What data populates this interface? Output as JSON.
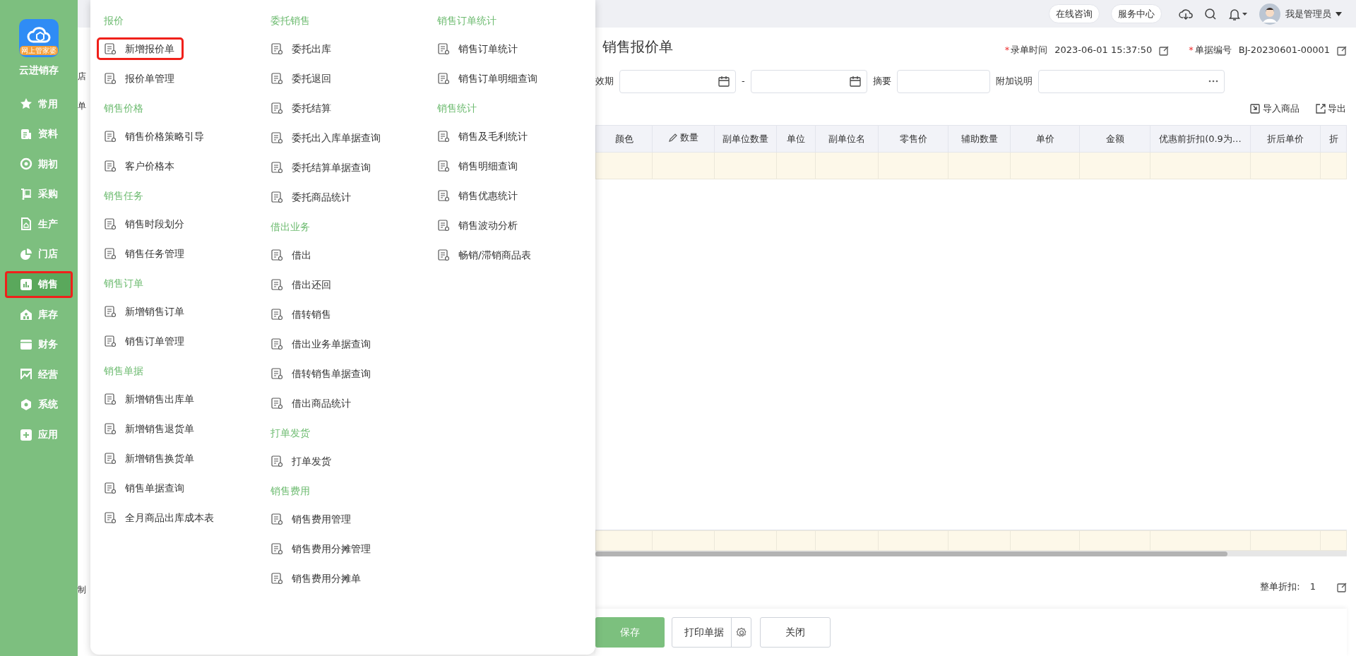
{
  "sidebar": {
    "logo_badge": "网上管家婆",
    "app_name": "云进销存",
    "items": [
      {
        "label": "常用",
        "selected": false,
        "highlighted": false
      },
      {
        "label": "资料",
        "selected": false,
        "highlighted": false
      },
      {
        "label": "期初",
        "selected": false,
        "highlighted": false
      },
      {
        "label": "采购",
        "selected": false,
        "highlighted": false
      },
      {
        "label": "生产",
        "selected": false,
        "highlighted": false
      },
      {
        "label": "门店",
        "selected": false,
        "highlighted": false
      },
      {
        "label": "销售",
        "selected": true,
        "highlighted": true
      },
      {
        "label": "库存",
        "selected": false,
        "highlighted": false
      },
      {
        "label": "财务",
        "selected": false,
        "highlighted": false
      },
      {
        "label": "经营",
        "selected": false,
        "highlighted": false
      },
      {
        "label": "系统",
        "selected": false,
        "highlighted": false
      },
      {
        "label": "应用",
        "selected": false,
        "highlighted": false
      }
    ]
  },
  "topbar": {
    "buttons": [
      "在线咨询",
      "服务中心"
    ],
    "user": "我是管理员"
  },
  "covered_labels": [
    "店",
    "单",
    "制"
  ],
  "menu": {
    "columns": [
      [
        {
          "title": "报价",
          "items": [
            {
              "label": "新增报价单",
              "highlighted": true
            },
            {
              "label": "报价单管理",
              "highlighted": false
            }
          ]
        },
        {
          "title": "销售价格",
          "items": [
            {
              "label": "销售价格策略引导",
              "highlighted": false
            },
            {
              "label": "客户价格本",
              "highlighted": false
            }
          ]
        },
        {
          "title": "销售任务",
          "items": [
            {
              "label": "销售时段划分",
              "highlighted": false
            },
            {
              "label": "销售任务管理",
              "highlighted": false
            }
          ]
        },
        {
          "title": "销售订单",
          "items": [
            {
              "label": "新增销售订单",
              "highlighted": false
            },
            {
              "label": "销售订单管理",
              "highlighted": false
            }
          ]
        },
        {
          "title": "销售单据",
          "items": [
            {
              "label": "新增销售出库单",
              "highlighted": false
            },
            {
              "label": "新增销售退货单",
              "highlighted": false
            },
            {
              "label": "新增销售换货单",
              "highlighted": false
            },
            {
              "label": "销售单据查询",
              "highlighted": false
            },
            {
              "label": "全月商品出库成本表",
              "highlighted": false
            }
          ]
        }
      ],
      [
        {
          "title": "委托销售",
          "items": [
            {
              "label": "委托出库",
              "highlighted": false
            },
            {
              "label": "委托退回",
              "highlighted": false
            },
            {
              "label": "委托结算",
              "highlighted": false
            },
            {
              "label": "委托出入库单据查询",
              "highlighted": false
            },
            {
              "label": "委托结算单据查询",
              "highlighted": false
            },
            {
              "label": "委托商品统计",
              "highlighted": false
            }
          ]
        },
        {
          "title": "借出业务",
          "items": [
            {
              "label": "借出",
              "highlighted": false
            },
            {
              "label": "借出还回",
              "highlighted": false
            },
            {
              "label": "借转销售",
              "highlighted": false
            },
            {
              "label": "借出业务单据查询",
              "highlighted": false
            },
            {
              "label": "借转销售单据查询",
              "highlighted": false
            },
            {
              "label": "借出商品统计",
              "highlighted": false
            }
          ]
        },
        {
          "title": "打单发货",
          "items": [
            {
              "label": "打单发货",
              "highlighted": false
            }
          ]
        },
        {
          "title": "销售费用",
          "items": [
            {
              "label": "销售费用管理",
              "highlighted": false
            },
            {
              "label": "销售费用分摊管理",
              "highlighted": false
            },
            {
              "label": "销售费用分摊单",
              "highlighted": false
            }
          ]
        }
      ],
      [
        {
          "title": "销售订单统计",
          "items": [
            {
              "label": "销售订单统计",
              "highlighted": false
            },
            {
              "label": "销售订单明细查询",
              "highlighted": false
            }
          ]
        },
        {
          "title": "销售统计",
          "items": [
            {
              "label": "销售及毛利统计",
              "highlighted": false
            },
            {
              "label": "销售明细查询",
              "highlighted": false
            },
            {
              "label": "销售优惠统计",
              "highlighted": false
            },
            {
              "label": "销售波动分析",
              "highlighted": false
            },
            {
              "label": "畅销/滞销商品表",
              "highlighted": false
            }
          ]
        }
      ]
    ]
  },
  "form": {
    "title": "销售报价单",
    "meta": [
      {
        "mark": "*",
        "label": "录单时间",
        "value": "2023-06-01 15:37:50"
      },
      {
        "mark": "*",
        "label": "单据编号",
        "value": "BJ-20230601-00001"
      }
    ],
    "validity_label": "效期",
    "separator": "-",
    "summary_label": "摘要",
    "note_label": "附加说明"
  },
  "toolbar": [
    {
      "label": "导入商品",
      "kind": "import"
    },
    {
      "label": "导出",
      "kind": "export"
    }
  ],
  "table": {
    "columns": [
      {
        "label": "颜色",
        "editable": false
      },
      {
        "label": "数量",
        "editable": true
      },
      {
        "label": "副单位数量",
        "editable": false
      },
      {
        "label": "单位",
        "editable": false
      },
      {
        "label": "副单位名",
        "editable": false
      },
      {
        "label": "零售价",
        "editable": false
      },
      {
        "label": "辅助数量",
        "editable": false
      },
      {
        "label": "单价",
        "editable": false
      },
      {
        "label": "金额",
        "editable": false
      },
      {
        "label": "优惠前折扣(0.9为…",
        "editable": false
      },
      {
        "label": "折后单价",
        "editable": false
      },
      {
        "label": "折",
        "editable": false
      }
    ]
  },
  "discount": {
    "label": "整单折扣:",
    "value": "1"
  },
  "actions": [
    {
      "label": "保存",
      "kind": "primary"
    },
    {
      "label": "打印单据",
      "kind": "split"
    },
    {
      "label": "关闭",
      "kind": "default"
    }
  ]
}
